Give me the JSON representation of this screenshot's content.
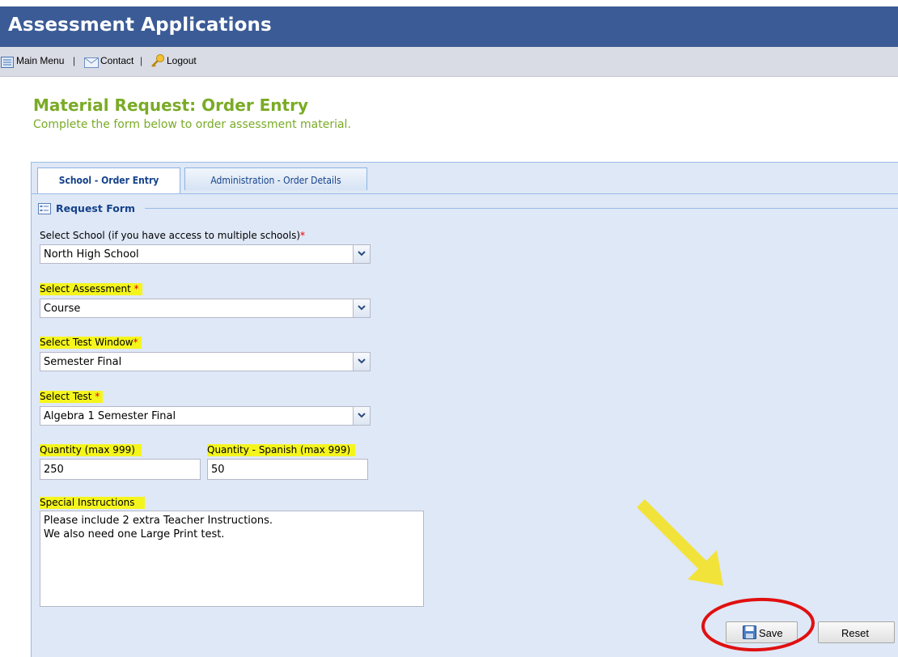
{
  "app": {
    "title": "Assessment Applications"
  },
  "menu": {
    "main_menu": "Main Menu",
    "contact": "Contact",
    "logout": "Logout",
    "separator": "|"
  },
  "page": {
    "title": "Material Request: Order Entry",
    "subtitle": "Complete the form below to order assessment material."
  },
  "tabs": [
    {
      "label": "School - Order Entry",
      "active": true
    },
    {
      "label": "Administration - Order Details",
      "active": false
    }
  ],
  "form": {
    "legend": "Request Form",
    "school": {
      "label": "Select School (if you have access to multiple schools)",
      "required": "*",
      "value": "North High School"
    },
    "assessment": {
      "label": "Select Assessment",
      "required": "*",
      "value": "Course"
    },
    "test_window": {
      "label": "Select Test Window",
      "required": "*",
      "value": "Semester Final"
    },
    "test": {
      "label": "Select Test",
      "required": "*",
      "value": "Algebra 1 Semester Final"
    },
    "quantity": {
      "label": "Quantity (max 999)",
      "value": "250"
    },
    "quantity_spanish": {
      "label": "Quantity - Spanish (max 999)",
      "value": "50"
    },
    "instructions": {
      "label": "Special Instructions",
      "line1": "Please include 2 extra Teacher Instructions.",
      "line2": "We also need one Large Print test."
    }
  },
  "buttons": {
    "save": "Save",
    "reset": "Reset"
  },
  "colors": {
    "header": "#3b5b96",
    "title_green": "#7aab26",
    "highlight": "#f5f51e",
    "annotation_red": "#e01010",
    "arrow_yellow": "#f2e33a"
  },
  "icons": [
    "menu-icon",
    "mail-icon",
    "key-icon",
    "form-icon",
    "save-disk-icon",
    "chevron-down-icon",
    "arrow-annotation",
    "circle-annotation"
  ]
}
